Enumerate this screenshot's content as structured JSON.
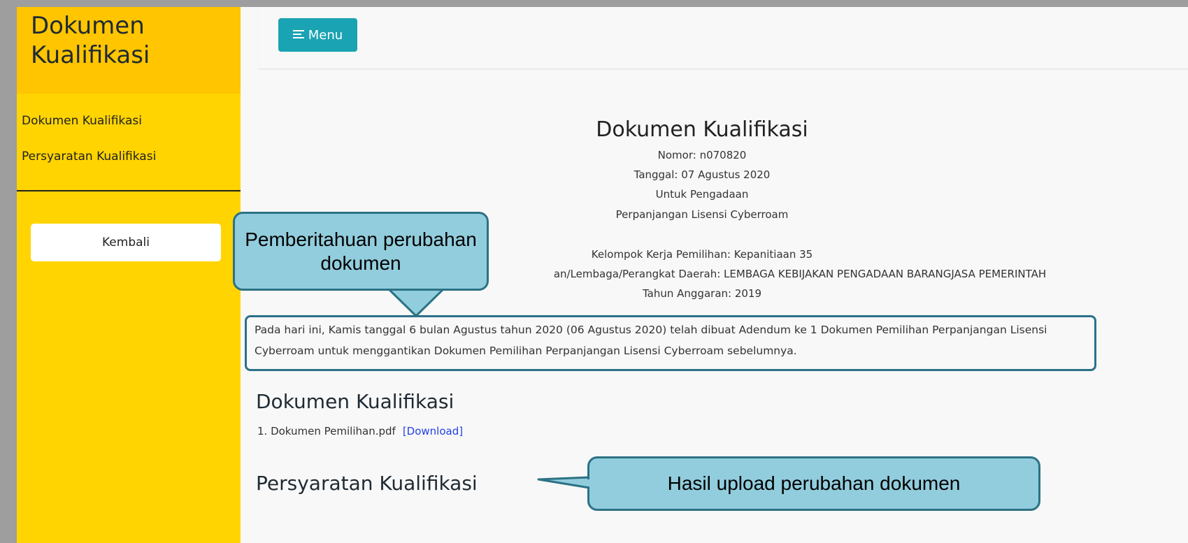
{
  "sidebar": {
    "title": "Dokumen Kualifikasi",
    "items": [
      {
        "label": "Dokumen Kualifikasi"
      },
      {
        "label": "Persyaratan Kualifikasi"
      }
    ],
    "back_label": "Kembali",
    "colors": {
      "background": "#FFD400",
      "header": "#FFC500"
    }
  },
  "navbar": {
    "menu_label": "Menu",
    "menu_icon": "menu-lines-icon",
    "menu_color": "#1aa3b3"
  },
  "document": {
    "title": "Dokumen Kualifikasi",
    "nomor": "Nomor: n070820",
    "tanggal": "Tanggal: 07 Agustus 2020",
    "untuk": "Untuk Pengadaan",
    "paket": "Perpanjangan Lisensi Cyberroam",
    "pokja": "Kelompok Kerja Pemilihan: Kepanitiaan 35",
    "klpd": "an/Lembaga/Perangkat Daerah: LEMBAGA KEBIJAKAN PENGADAAN BARANGJASA PEMERINTAH",
    "tahun": "Tahun Anggaran: 2019",
    "announcement_line1": "Pada hari ini, Kamis tanggal 6 bulan Agustus tahun 2020 (06 Agustus 2020) telah dibuat Adendum ke 1 Dokumen Pemilihan Perpanjangan Lisensi",
    "announcement_line2": "Cyberroam untuk menggantikan Dokumen Pemilihan Perpanjangan Lisensi Cyberroam sebelumnya."
  },
  "sections": {
    "dokumen_heading": "Dokumen Kualifikasi",
    "file_name": "1. Dokumen Pemilihan.pdf",
    "download_label": "[Download]",
    "persyaratan_heading": "Persyaratan Kualifikasi"
  },
  "callouts": {
    "change_notice": "Pemberitahuan perubahan dokumen",
    "upload_result": "Hasil upload perubahan dokumen",
    "color_fill": "#92cddd",
    "color_border": "#2c7285"
  }
}
